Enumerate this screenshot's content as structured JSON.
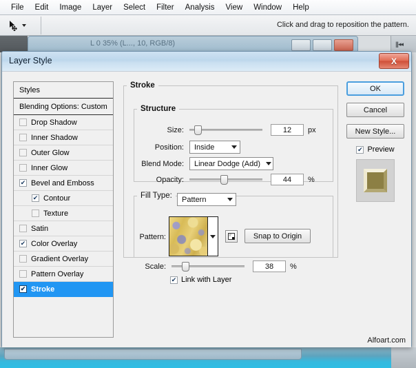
{
  "app": {
    "menu": [
      "File",
      "Edit",
      "Image",
      "Layer",
      "Select",
      "Filter",
      "Analysis",
      "View",
      "Window",
      "Help"
    ],
    "options_hint": "Click and drag to reposition the pattern.",
    "tool_icon": "move-tool-icon",
    "document_title": "L 0 35% (L..., 10, RGB/8)"
  },
  "dialog": {
    "title": "Layer Style",
    "close_label": "X",
    "styles_header": "Styles",
    "blending_options": "Blending Options: Custom",
    "styles": [
      {
        "label": "Drop Shadow",
        "checked": false,
        "sub": false,
        "selected": false
      },
      {
        "label": "Inner Shadow",
        "checked": false,
        "sub": false,
        "selected": false
      },
      {
        "label": "Outer Glow",
        "checked": false,
        "sub": false,
        "selected": false
      },
      {
        "label": "Inner Glow",
        "checked": false,
        "sub": false,
        "selected": false
      },
      {
        "label": "Bevel and Emboss",
        "checked": true,
        "sub": false,
        "selected": false
      },
      {
        "label": "Contour",
        "checked": true,
        "sub": true,
        "selected": false
      },
      {
        "label": "Texture",
        "checked": false,
        "sub": true,
        "selected": false
      },
      {
        "label": "Satin",
        "checked": false,
        "sub": false,
        "selected": false
      },
      {
        "label": "Color Overlay",
        "checked": true,
        "sub": false,
        "selected": false
      },
      {
        "label": "Gradient Overlay",
        "checked": false,
        "sub": false,
        "selected": false
      },
      {
        "label": "Pattern Overlay",
        "checked": false,
        "sub": false,
        "selected": false
      },
      {
        "label": "Stroke",
        "checked": true,
        "sub": false,
        "selected": true
      }
    ],
    "stroke": {
      "group_title": "Stroke",
      "structure": {
        "group_title": "Structure",
        "size_label": "Size:",
        "size_value": "12",
        "size_unit": "px",
        "size_percent": 9,
        "position_label": "Position:",
        "position_value": "Inside",
        "blend_mode_label": "Blend Mode:",
        "blend_mode_value": "Linear Dodge (Add)",
        "opacity_label": "Opacity:",
        "opacity_value": "44",
        "opacity_unit": "%",
        "opacity_percent": 44
      },
      "fill": {
        "fill_type_label": "Fill Type:",
        "fill_type_value": "Pattern",
        "pattern_label": "Pattern:",
        "new_pattern_icon": "new-pattern-icon",
        "snap_to_origin_label": "Snap to Origin",
        "scale_label": "Scale:",
        "scale_value": "38",
        "scale_unit": "%",
        "scale_percent": 17,
        "link_with_layer_label": "Link with Layer",
        "link_with_layer_checked": true
      }
    },
    "buttons": {
      "ok": "OK",
      "cancel": "Cancel",
      "new_style": "New Style...",
      "preview_label": "Preview",
      "preview_checked": true
    }
  },
  "watermark": "Alfoart.com",
  "colors": {
    "selection_blue": "#2196f3",
    "focus_blue": "#4a9ede",
    "close_red": "#cf4f38",
    "pattern_gold": "#e3c24f",
    "status_teal": "#2fbde4"
  }
}
